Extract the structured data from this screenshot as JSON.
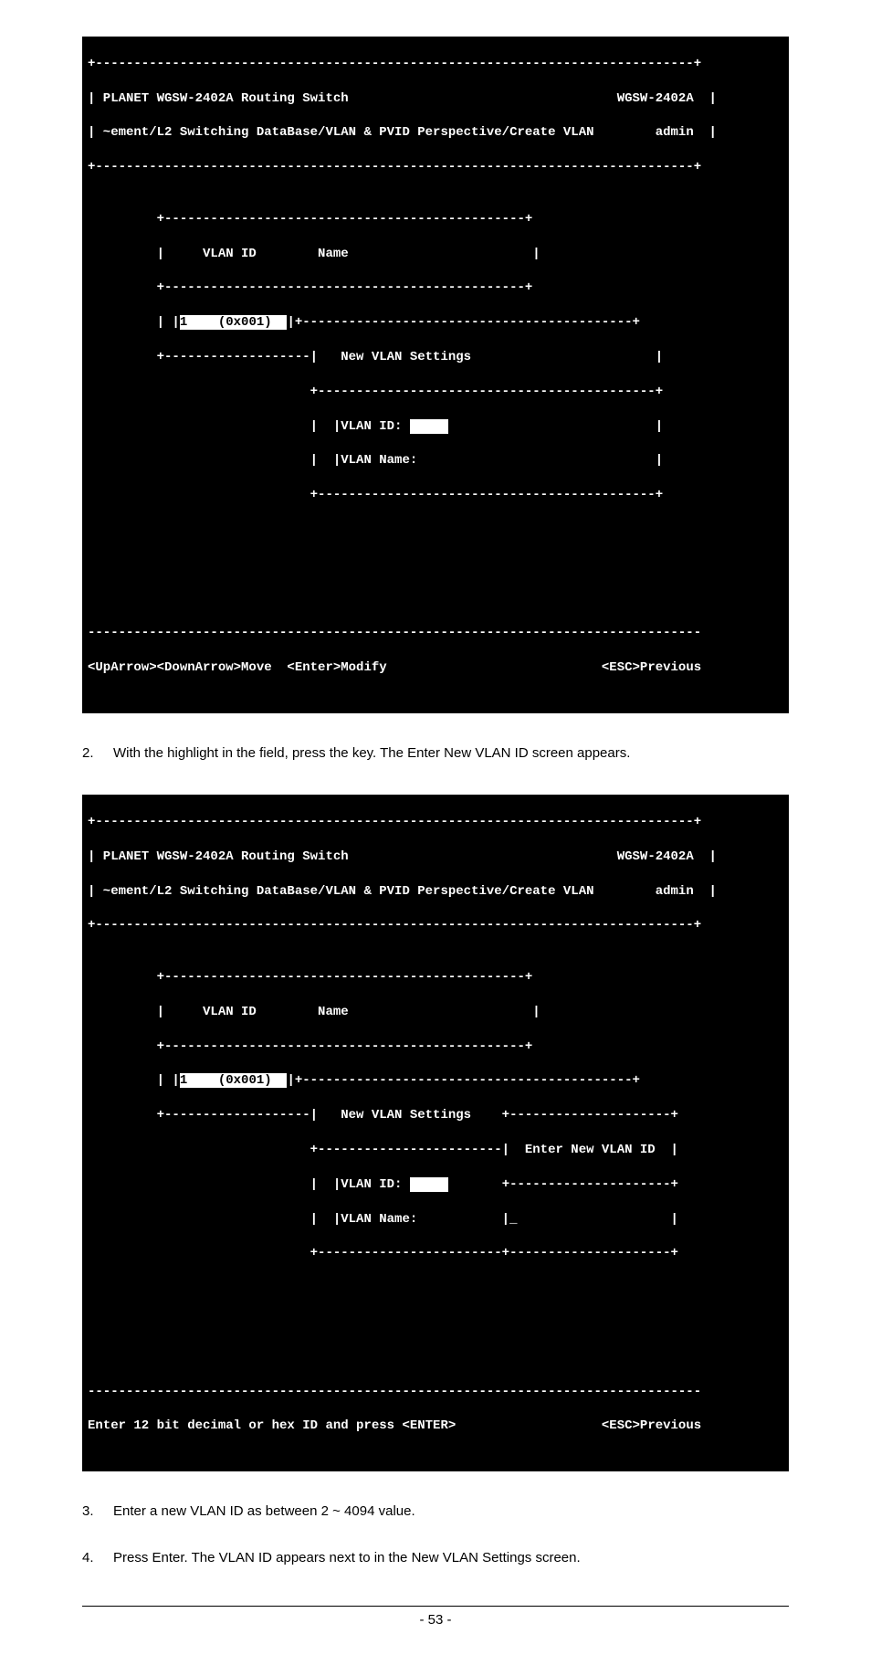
{
  "term1": {
    "top_border": "+------------------------------------------------------------------------------+",
    "header_l1a": "| PLANET WGSW-2402A Routing Switch",
    "header_l1b": "WGSW-2402A  |",
    "header_l2a": "| ~ement/L2 Switching DataBase/VLAN & PVID Perspective/Create VLAN",
    "header_l2b": "admin  |",
    "sep": "+------------------------------------------------------------------------------+",
    "blank": "",
    "inner_top": "         +-----------------------------------------------+",
    "col_a": "         |     VLAN ID        Name                        |",
    "col_b": "         +-----------------------------------------------+",
    "row1_a": "         | |",
    "row1_hl": "1    (0x001)  ",
    "row1_b": "|+-------------------------------------------+",
    "settings_a": "         +-------------------|   New VLAN Settings                        |",
    "settings_b": "                             +--------------------------------------------+",
    "vlanid_a": "                             |  |VLAN ID:",
    "vlanid_hl": "     ",
    "vlanid_b": "                           |",
    "vlanname": "                             |  |VLAN Name:                               |",
    "settings_c": "                             +--------------------------------------------+",
    "foot_sep": "--------------------------------------------------------------------------------",
    "foot_a": "<UpArrow><DownArrow>Move  <Enter>Modify",
    "foot_b": "<ESC>Previous"
  },
  "step2": {
    "num": "2.",
    "text_a": "With the highlight in the ",
    "text_b": " field, press the ",
    "text_c": " key. The Enter New VLAN ID screen appears."
  },
  "term2": {
    "top_border": "+------------------------------------------------------------------------------+",
    "header_l1a": "| PLANET WGSW-2402A Routing Switch",
    "header_l1b": "WGSW-2402A  |",
    "header_l2a": "| ~ement/L2 Switching DataBase/VLAN & PVID Perspective/Create VLAN",
    "header_l2b": "admin  |",
    "sep": "+------------------------------------------------------------------------------+",
    "blank": "",
    "inner_top": "         +-----------------------------------------------+",
    "col_a": "         |     VLAN ID        Name                        |",
    "col_b": "         +-----------------------------------------------+",
    "row1_a": "         | |",
    "row1_hl": "1    (0x001)  ",
    "row1_b": "|+-------------------------------------------+",
    "settings_a": "         +-------------------|   New VLAN Settings    +---------------------+",
    "ent_a": "                             +------------------------|  Enter New VLAN ID  |",
    "vlanid_a": "                             |  |VLAN ID:",
    "vlanid_hl": "     ",
    "vlanid_b": "       +---------------------+",
    "vlanname_a": "                             |  |VLAN Name:           |_                    |",
    "settings_c": "                             +------------------------+---------------------+",
    "foot_sep": "--------------------------------------------------------------------------------",
    "foot_a": "Enter 12 bit decimal or hex ID and press <ENTER>",
    "foot_b": "<ESC>Previous"
  },
  "step3": {
    "num": "3.",
    "text": "Enter a new VLAN ID as between 2 ~ 4094 value."
  },
  "step4": {
    "num": "4.",
    "text_a": "Press Enter. The VLAN ID appears next to ",
    "text_b": " in the New VLAN Settings screen."
  },
  "footer": {
    "page": "- 53 -"
  }
}
